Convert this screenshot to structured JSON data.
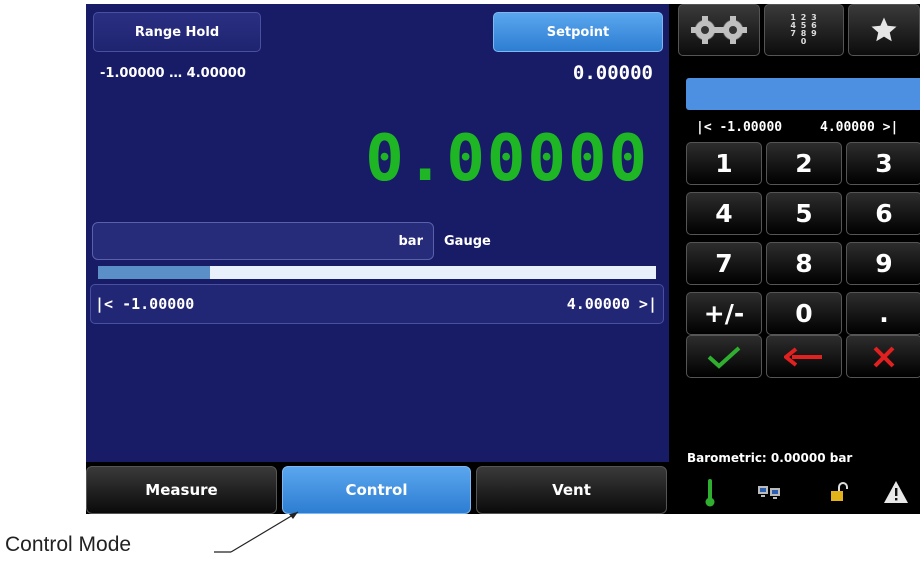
{
  "header": {
    "range_hold_label": "Range Hold",
    "setpoint_label": "Setpoint"
  },
  "display": {
    "range_text": "-1.00000 … 4.00000",
    "setpoint_value": "0.00000",
    "reading": "0.00000",
    "unit": "bar",
    "mode": "Gauge",
    "progress": 0.2,
    "range_min": "|<  -1.00000",
    "range_max": "4.00000  >|"
  },
  "tabs": {
    "measure": "Measure",
    "control": "Control",
    "vent": "Vent"
  },
  "keypad": {
    "range_min": "|<  -1.00000",
    "range_max": "4.00000  >|",
    "keys": [
      "1",
      "2",
      "3",
      "4",
      "5",
      "6",
      "7",
      "8",
      "9",
      "+/-",
      "0",
      "."
    ],
    "numpad_icon_text": "1 2 3\n4 5 6\n7 8 9\n0"
  },
  "status": {
    "barometric": "Barometric:  0.00000 bar"
  },
  "annotation": {
    "callout": "Control Mode"
  },
  "icons": [
    "gears-icon",
    "numpad-icon",
    "star-icon",
    "thermometer-icon",
    "network-icon",
    "unlock-icon",
    "warning-icon",
    "check-icon",
    "backspace-arrow-icon",
    "clear-x-icon"
  ],
  "colors": {
    "panel_bg": "#181c66",
    "accent_blue": "#3b8de0",
    "reading_green": "#1fb626",
    "check_green": "#2fae2f",
    "cancel_red": "#e12020"
  }
}
